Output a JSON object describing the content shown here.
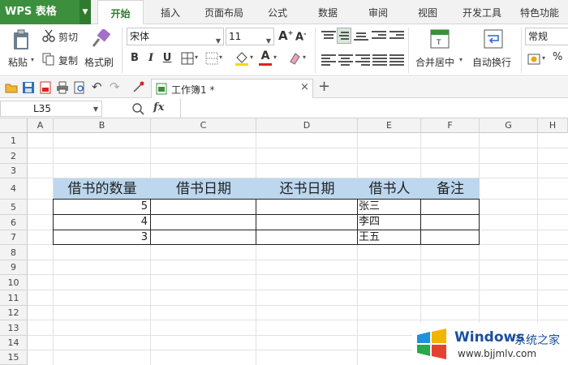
{
  "app": {
    "logo_label": "WPS 表格"
  },
  "ribbon_tabs": [
    {
      "label": "开始",
      "active": true
    },
    {
      "label": "插入"
    },
    {
      "label": "页面布局"
    },
    {
      "label": "公式"
    },
    {
      "label": "数据"
    },
    {
      "label": "审阅"
    },
    {
      "label": "视图"
    },
    {
      "label": "开发工具"
    },
    {
      "label": "特色功能"
    }
  ],
  "ribbon": {
    "paste_label": "粘贴",
    "cut_label": "剪切",
    "copy_label": "复制",
    "format_painter_label": "格式刷",
    "font_name": "宋体",
    "font_size": "11",
    "bold": "B",
    "italic": "I",
    "underline": "U",
    "merge_center_label": "合并居中",
    "wrap_label": "自动换行",
    "number_format": "常规",
    "percent": "%"
  },
  "doc_tab": {
    "label": "工作簿1 *"
  },
  "formula_bar": {
    "name_box": "L35",
    "fx": "fx",
    "value": ""
  },
  "columns": [
    "A",
    "B",
    "C",
    "D",
    "E",
    "F",
    "G",
    "H"
  ],
  "rows": [
    "1",
    "2",
    "3",
    "4",
    "5",
    "6",
    "7",
    "8",
    "9",
    "10",
    "11",
    "12",
    "13",
    "14",
    "15"
  ],
  "table": {
    "headers": [
      "借书的数量",
      "借书日期",
      "还书日期",
      "借书人",
      "备注"
    ],
    "rows": [
      {
        "quantity": "5",
        "borrow_date": "",
        "return_date": "",
        "borrower": "张三",
        "note": ""
      },
      {
        "quantity": "4",
        "borrow_date": "",
        "return_date": "",
        "borrower": "李四",
        "note": ""
      },
      {
        "quantity": "3",
        "borrow_date": "",
        "return_date": "",
        "borrower": "王五",
        "note": ""
      }
    ]
  },
  "watermark": {
    "brand": "Windows",
    "site_cn": "系统之家",
    "site_url": "www.bjjmlv.com"
  },
  "colors": {
    "accent": "#3c8f3c",
    "header_fill": "#bdd7ee"
  }
}
